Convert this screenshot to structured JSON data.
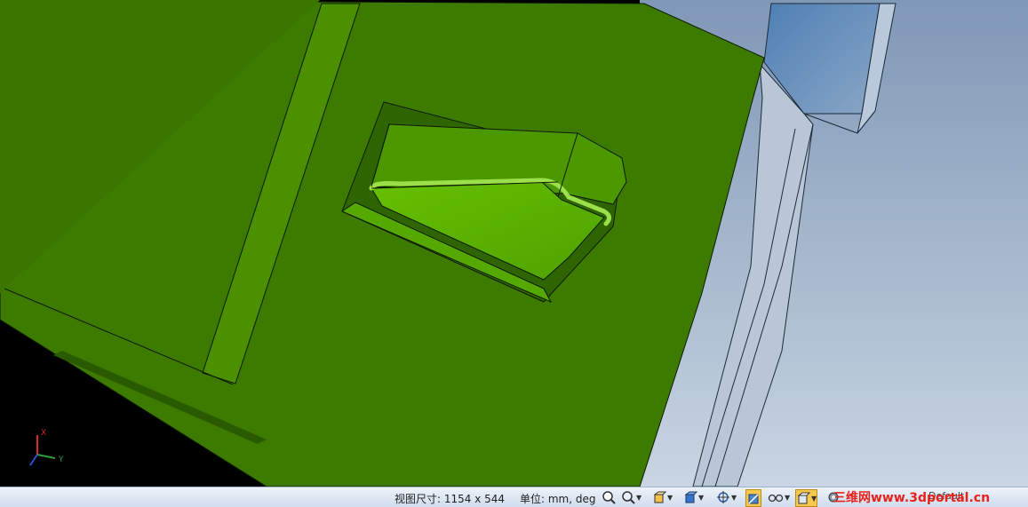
{
  "viewport": {
    "triad": {
      "x_label": "X",
      "y_label": "Y",
      "x_color": "#d8262b",
      "y_color": "#2d9c3a",
      "z_color": "#2f4fd1"
    },
    "part_color": "#3c7a00",
    "face_highlight_color": "#5cb000",
    "background_right": "#9bb0c9"
  },
  "statusbar": {
    "view_size_label": "视图尺寸: 1154 x 544",
    "units_label": "单位: mm, deg",
    "toolbar_icons": [
      "zoom-icon",
      "zoom-area-icon",
      "view-orientation-icon",
      "display-style-icon",
      "rotate-center-icon",
      "section-view-icon",
      "glasses-icon",
      "shaded-cube-icon",
      "gear-icon"
    ],
    "default_label": "Default",
    "watermark": "三维网www.3dportal.cn"
  }
}
